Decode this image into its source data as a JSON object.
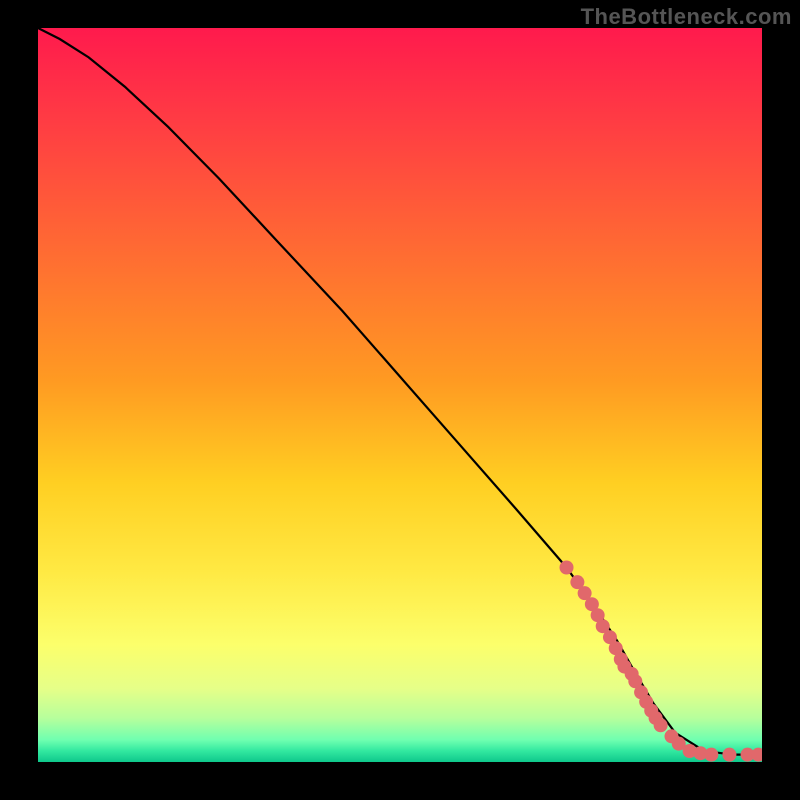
{
  "watermark": "TheBottleneck.com",
  "chart_data": {
    "type": "line",
    "title": "",
    "xlabel": "",
    "ylabel": "",
    "xlim": [
      0,
      100
    ],
    "ylim": [
      0,
      100
    ],
    "gradient_stops": [
      {
        "offset": 0.0,
        "color": "#ff1a4d"
      },
      {
        "offset": 0.12,
        "color": "#ff3a44"
      },
      {
        "offset": 0.3,
        "color": "#ff6a33"
      },
      {
        "offset": 0.48,
        "color": "#ff9a22"
      },
      {
        "offset": 0.62,
        "color": "#ffcf22"
      },
      {
        "offset": 0.74,
        "color": "#ffe943"
      },
      {
        "offset": 0.84,
        "color": "#fcff6b"
      },
      {
        "offset": 0.9,
        "color": "#e6ff88"
      },
      {
        "offset": 0.94,
        "color": "#b7ff9c"
      },
      {
        "offset": 0.97,
        "color": "#6fffb0"
      },
      {
        "offset": 0.985,
        "color": "#32e8a0"
      },
      {
        "offset": 1.0,
        "color": "#0ec78b"
      }
    ],
    "series": [
      {
        "name": "curve",
        "type": "line",
        "color": "#000000",
        "x": [
          0,
          3,
          7,
          12,
          18,
          25,
          33,
          42,
          50,
          58,
          66,
          73,
          77,
          80,
          82,
          85,
          88,
          92,
          96,
          100
        ],
        "y": [
          100,
          98.5,
          96,
          92,
          86.5,
          79.5,
          71,
          61.5,
          52.5,
          43.5,
          34.5,
          26.5,
          21,
          16.5,
          13,
          8,
          4,
          1.5,
          1,
          1
        ]
      },
      {
        "name": "dots",
        "type": "scatter",
        "color": "#e1686b",
        "x": [
          73,
          74.5,
          75.5,
          76.5,
          77.3,
          78,
          79,
          79.8,
          80.5,
          81,
          82,
          82.5,
          83.3,
          84,
          84.7,
          85.3,
          86,
          87.5,
          88.5,
          90,
          91.5,
          93,
          95.5,
          98,
          99.5
        ],
        "y": [
          26.5,
          24.5,
          23,
          21.5,
          20,
          18.5,
          17,
          15.5,
          14,
          13,
          12,
          11,
          9.5,
          8.2,
          7,
          6,
          5,
          3.5,
          2.5,
          1.5,
          1.2,
          1,
          1,
          1,
          1
        ]
      }
    ]
  }
}
